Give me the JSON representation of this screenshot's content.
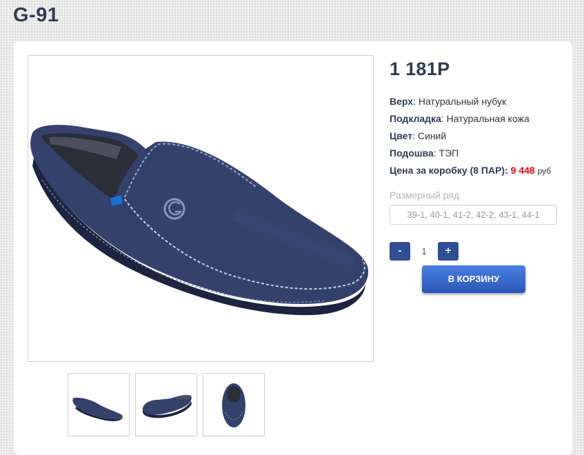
{
  "page": {
    "title": "G-91"
  },
  "product": {
    "price": "1 181Р",
    "specs": [
      {
        "label": "Верх",
        "value": "Натуральный нубук"
      },
      {
        "label": "Подкладка",
        "value": "Натуральная кожа"
      },
      {
        "label": "Цвет",
        "value": "Синий"
      },
      {
        "label": "Подошва",
        "value": "ТЭП"
      }
    ],
    "box_price": {
      "label": "Цена за коробку (8 ПАР):",
      "amount": "9 448",
      "currency": "руб"
    },
    "size_range": {
      "label": "Размерный ряд",
      "value": "39-1, 40-1, 41-2, 42-2, 43-1, 44-1"
    },
    "quantity": {
      "minus": "-",
      "value": "1",
      "plus": "+"
    },
    "add_to_cart": "В КОРЗИНУ"
  },
  "gallery": {
    "main_icon": "shoe-photo",
    "thumbnails": [
      "shoe-side-view",
      "shoe-angle-view",
      "shoe-top-view"
    ]
  },
  "colors": {
    "accent": "#2f4f93",
    "button": "#2a56b8",
    "price_red": "#e30613",
    "title": "#2f3b52",
    "shoe": "#34416b"
  }
}
